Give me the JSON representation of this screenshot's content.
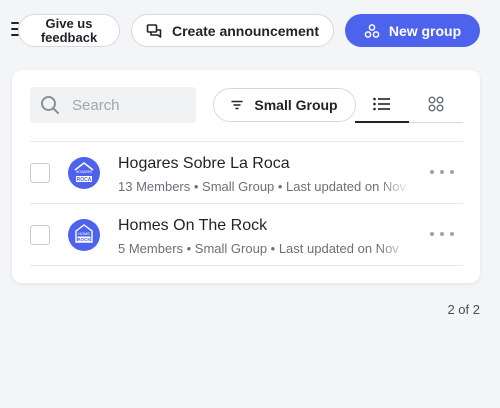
{
  "header": {
    "feedback_label": "Give us feedback",
    "announcement_label": "Create announcement",
    "new_group_label": "New group"
  },
  "toolbar": {
    "search_placeholder": "Search",
    "filter_label": "Small Group",
    "views": [
      "list",
      "grid"
    ],
    "active_view": "list"
  },
  "groups": [
    {
      "name": "Hogares Sobre La Roca",
      "meta": "13 Members • Small Group • Last updated on Nov",
      "avatar_top": "HOGARES",
      "avatar_bottom": "ROCA"
    },
    {
      "name": "Homes On The Rock",
      "meta": "5 Members • Small Group • Last updated on Nov",
      "avatar_top": "HOME",
      "avatar_bottom": "ROCK"
    }
  ],
  "pagination": {
    "label": "2 of 2"
  },
  "colors": {
    "primary": "#4d63ee",
    "background": "#f4f5f7",
    "text": "#1f2328",
    "muted": "#6b7078"
  }
}
